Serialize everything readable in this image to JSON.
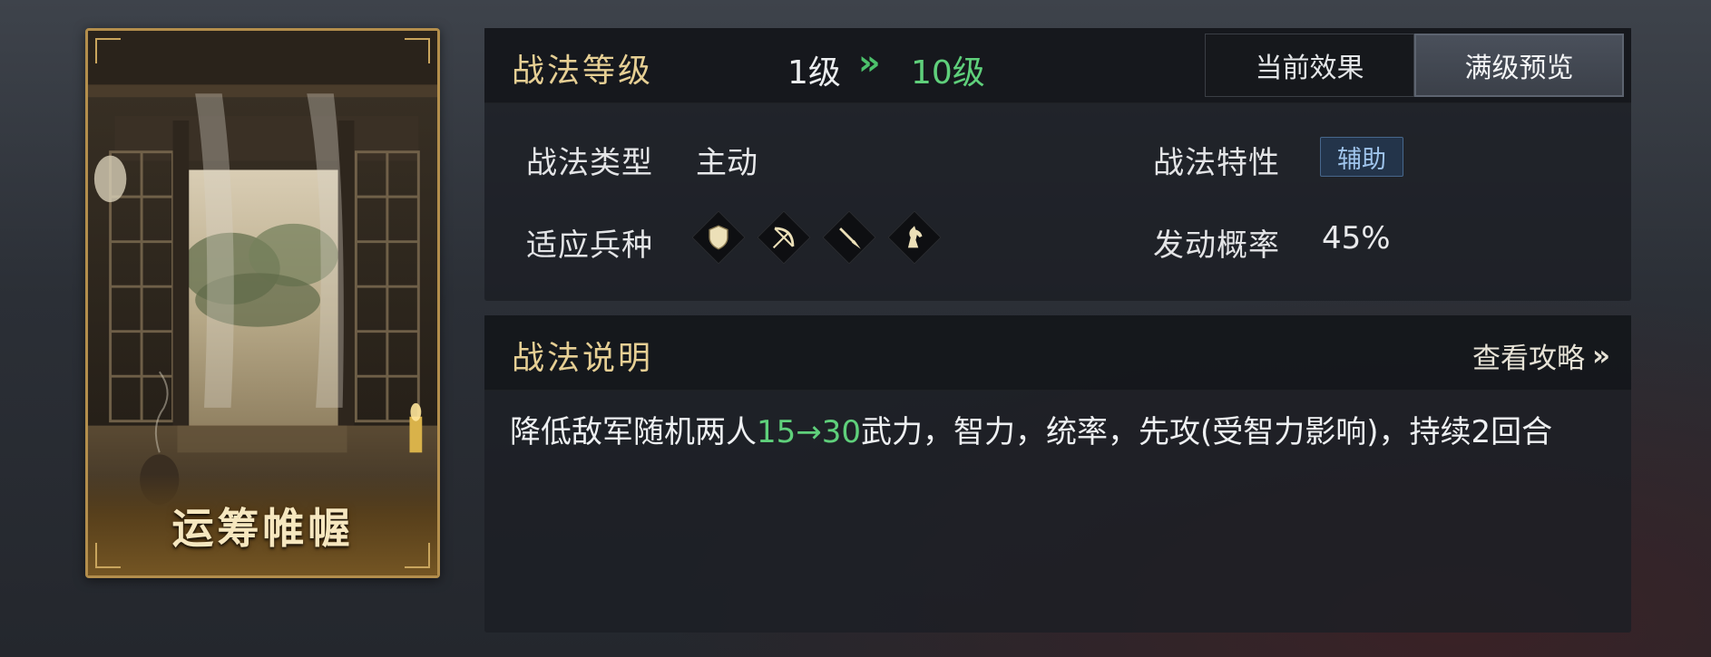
{
  "skill_card": {
    "name": "运筹帷幄"
  },
  "level_panel": {
    "title": "战法等级",
    "level_from": "1级",
    "level_arrows": "»",
    "level_to": "10级",
    "tabs": [
      {
        "label": "当前效果",
        "active": false
      },
      {
        "label": "满级预览",
        "active": true
      }
    ]
  },
  "attributes": {
    "type_label": "战法类型",
    "type_value": "主动",
    "trait_label": "战法特性",
    "trait_value": "辅助",
    "troops_label": "适应兵种",
    "troop_icons": [
      "shield-icon",
      "bow-icon",
      "spear-icon",
      "horse-icon"
    ],
    "chance_label": "发动概率",
    "chance_value": "45%"
  },
  "description_panel": {
    "title": "战法说明",
    "guide_link": "查看攻略",
    "guide_arrows": "»",
    "text_before": "降低敌军随机两人",
    "text_highlight": "15→30",
    "text_after": "武力，智力，统率，先攻(受智力影响)，持续2回合"
  },
  "colors": {
    "gold_title": "#e6cf94",
    "green_value": "#5fd07b",
    "badge_blue": "#9fc4ec",
    "card_border": "#b38e4c"
  }
}
